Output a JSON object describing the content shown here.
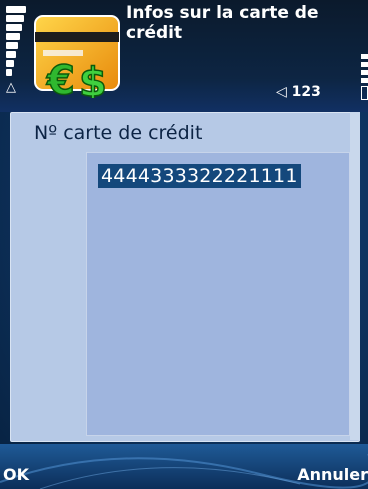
{
  "header": {
    "title": "Infos sur la carte de crédit",
    "message_indicator": "◁ 123",
    "app_icon": "credit-card-icon"
  },
  "form": {
    "field_label": "Nº carte de crédit",
    "field_value": "4444333322221111"
  },
  "softkeys": {
    "left": "OK",
    "right": "Annuler"
  },
  "colors": {
    "panel": "#b6c9e6",
    "field": "#9fb5de",
    "selection": "#14487c",
    "label_text": "#0c2445"
  }
}
